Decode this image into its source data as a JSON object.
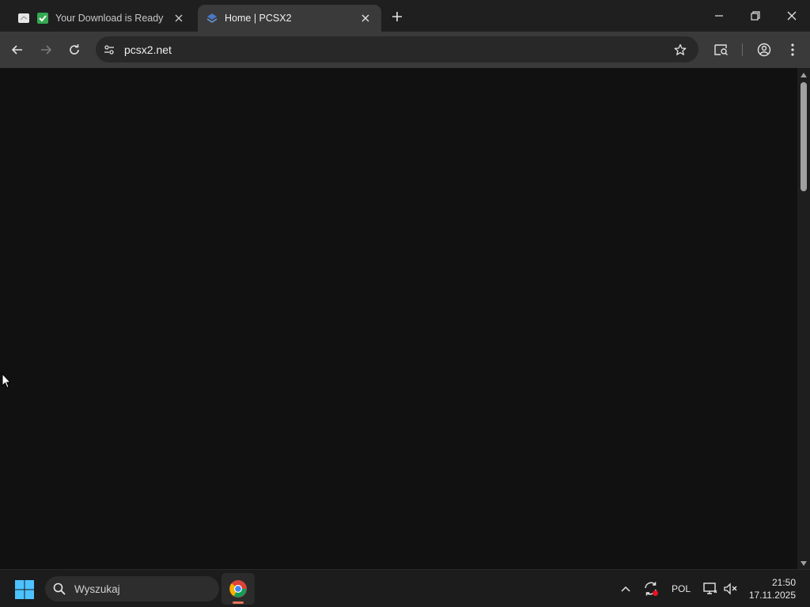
{
  "tabs": [
    {
      "title": "Your Download is Ready",
      "active": false
    },
    {
      "title": "Home | PCSX2",
      "active": true
    }
  ],
  "toolbar": {
    "url": "pcsx2.net"
  },
  "taskbar": {
    "search_placeholder": "Wyszukaj",
    "language": "POL",
    "time": "21:50",
    "date": "17.11.2025"
  },
  "colors": {
    "content_bg": "#111111",
    "toolbar_bg": "#3a3a3a",
    "tabstrip_bg": "#1f1f1f",
    "taskbar_bg": "#1c1c1c"
  },
  "icons": {
    "tab1_favicons": [
      "page-icon",
      "checkmark-icon"
    ],
    "tab2_favicon": "pcsx2-logo-icon",
    "toolbar": [
      "back-icon",
      "forward-icon",
      "reload-icon",
      "site-settings-icon",
      "star-icon",
      "tab-search-icon",
      "profile-icon",
      "menu-icon"
    ],
    "window": [
      "minimize-icon",
      "restore-icon",
      "close-icon"
    ],
    "taskbar": [
      "windows-start-icon",
      "search-icon",
      "chrome-icon",
      "chevron-up-icon",
      "sync-icon",
      "network-icon",
      "sound-muted-icon"
    ]
  }
}
